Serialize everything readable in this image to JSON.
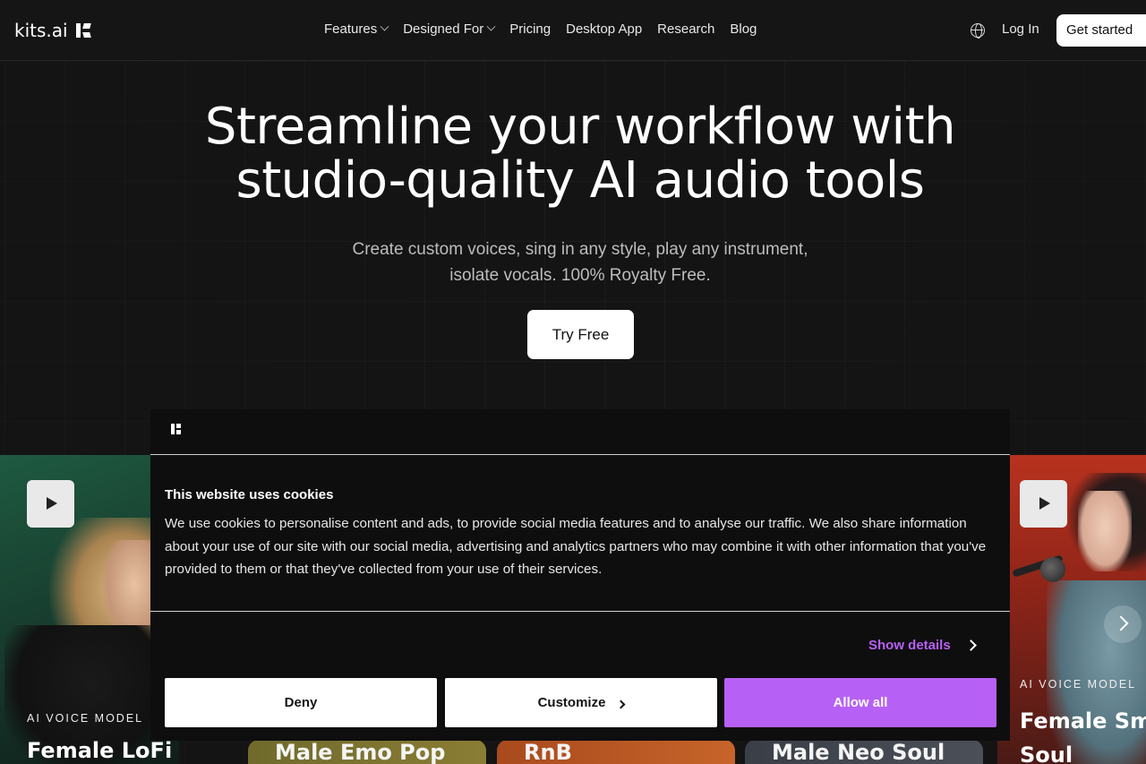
{
  "nav": {
    "logo_text": "kits.ai",
    "links": [
      {
        "label": "Features",
        "has_caret": true
      },
      {
        "label": "Designed For",
        "has_caret": true
      },
      {
        "label": "Pricing",
        "has_caret": false
      },
      {
        "label": "Desktop App",
        "has_caret": false
      },
      {
        "label": "Research",
        "has_caret": false
      },
      {
        "label": "Blog",
        "has_caret": false
      }
    ],
    "globe_icon": "globe-icon",
    "login_label": "Log In",
    "get_started_label": "Get started"
  },
  "hero": {
    "title_line1": "Streamline your workflow with",
    "title_line2": "studio-quality AI audio tools",
    "subtitle_line1": "Create custom voices, sing in any style, play any instrument,",
    "subtitle_line2": "isolate vocals. 100% Royalty Free.",
    "cta_label": "Try Free"
  },
  "cards": {
    "left": {
      "kicker": "AI VOICE MODEL",
      "title": "Female LoFi"
    },
    "middle": [
      {
        "title": "Male Emo Pop"
      },
      {
        "title": "RnB"
      },
      {
        "title": "Male Neo Soul"
      }
    ],
    "right": {
      "kicker": "AI VOICE MODEL",
      "title_line1": "Female Sm",
      "title_line2": "Soul"
    }
  },
  "cookie": {
    "heading": "This website uses cookies",
    "body": "We use cookies to personalise content and ads, to provide social media features and to analyse our traffic. We also share information about your use of our site with our social media, advertising and analytics partners who may combine it with other information that you've provided to them or that they've collected from your use of their services.",
    "show_details_label": "Show details",
    "deny_label": "Deny",
    "customize_label": "Customize",
    "allow_all_label": "Allow all",
    "accent_color": "#b760f5"
  }
}
